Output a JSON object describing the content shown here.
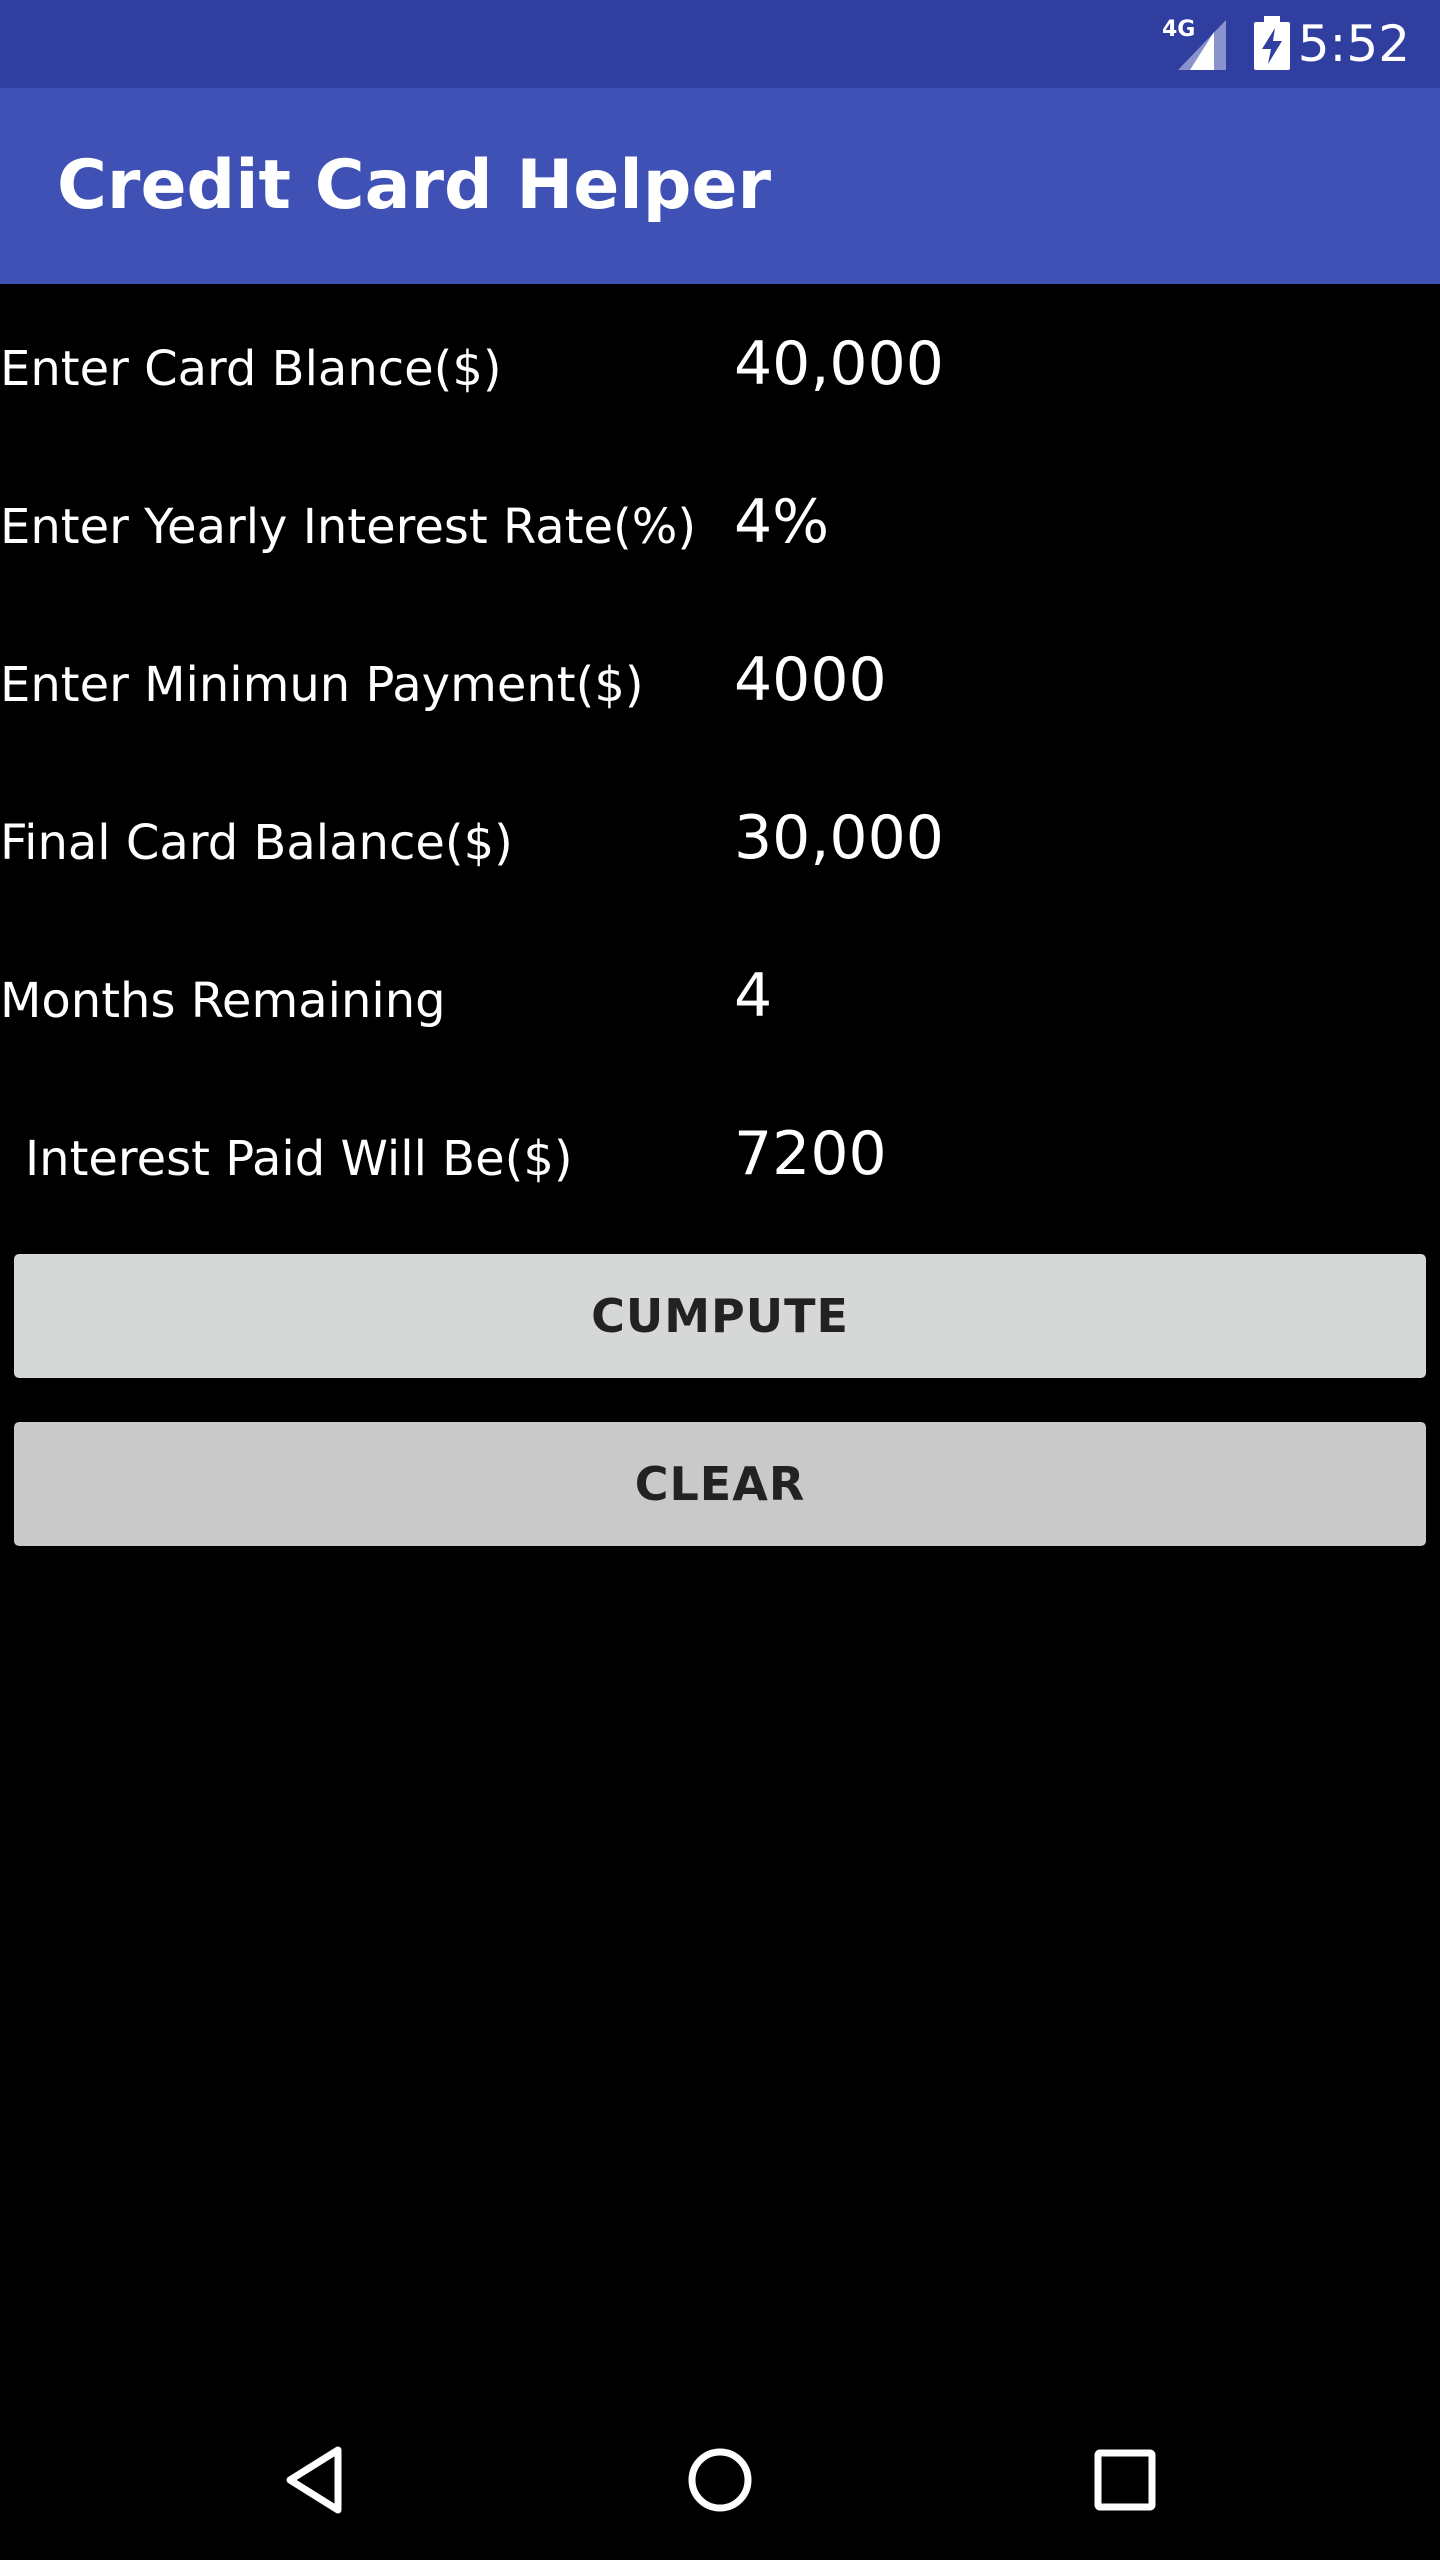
{
  "status_bar": {
    "network": "4G",
    "time": "5:52",
    "icons": [
      "signal-icon",
      "battery-charging-icon"
    ]
  },
  "app_bar": {
    "title": "Credit Card Helper"
  },
  "form": {
    "rows": [
      {
        "label": "Enter Card Blance($)",
        "value": "40,000"
      },
      {
        "label": "Enter Yearly Interest Rate(%)",
        "value": "4%"
      },
      {
        "label": "Enter Minimun Payment($)",
        "value": "4000"
      },
      {
        "label": "Final Card Balance($)",
        "value": "30,000"
      },
      {
        "label": "Months Remaining",
        "value": "4"
      },
      {
        "label": "Interest Paid Will Be($)",
        "value": "7200"
      }
    ]
  },
  "buttons": {
    "compute": "CUMPUTE",
    "clear": "CLEAR"
  },
  "nav_bar": {
    "icons": [
      "back-icon",
      "home-icon",
      "recents-icon"
    ]
  },
  "colors": {
    "status_bar": "#303f9f",
    "app_bar": "#3f51b5",
    "background": "#000000"
  }
}
